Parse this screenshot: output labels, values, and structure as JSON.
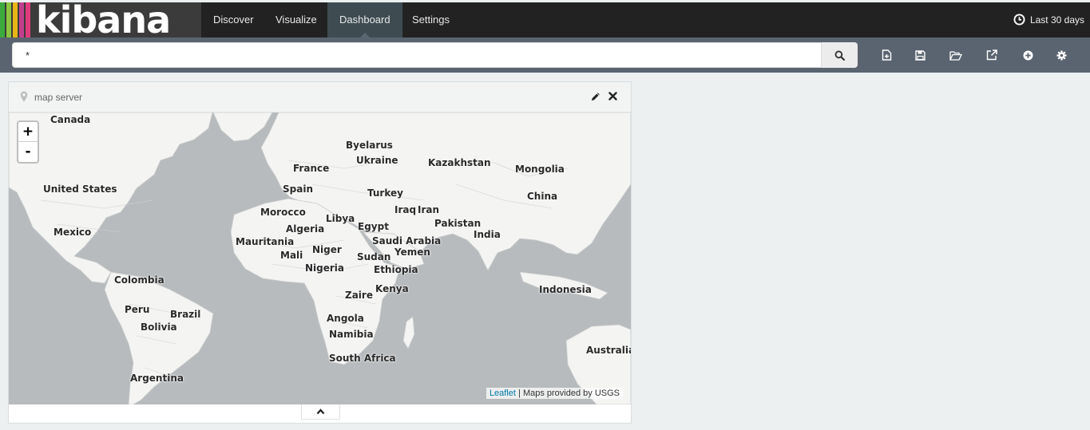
{
  "brand": {
    "logo_text": "kibana",
    "stripe_colors": [
      "#3caa3c",
      "#8cc63f",
      "#e8b416",
      "#c23e8c",
      "#e03b7c"
    ]
  },
  "nav": {
    "tabs": [
      {
        "label": "Discover"
      },
      {
        "label": "Visualize"
      },
      {
        "label": "Dashboard",
        "active": true
      },
      {
        "label": "Settings"
      }
    ],
    "timepicker_label": "Last 30 days"
  },
  "search": {
    "query": "*",
    "icon": "search-icon"
  },
  "toolbar": {
    "icons": [
      "new-dashboard-icon",
      "save-icon",
      "open-icon",
      "share-icon",
      "add-panel-icon",
      "settings-icon"
    ]
  },
  "panel": {
    "title": "map server",
    "title_icon": "map-pin-icon",
    "edit_icon": "pencil-icon",
    "close_icon": "close-icon"
  },
  "map": {
    "zoom_in": "+",
    "zoom_out": "-",
    "attribution_link": "Leaflet",
    "attribution_text": "| Maps provided by USGS",
    "countries": [
      "Canada",
      "United States",
      "Mexico",
      "Colombia",
      "Peru",
      "Brazil",
      "Bolivia",
      "Argentina",
      "Byelarus",
      "Ukraine",
      "France",
      "Spain",
      "Kazakhstan",
      "Mongolia",
      "China",
      "Turkey",
      "Morocco",
      "Libya",
      "Iraq",
      "Iran",
      "Algeria",
      "Egypt",
      "Pakistan",
      "India",
      "Mauritania",
      "Saudi Arabia",
      "Niger",
      "Mali",
      "Sudan",
      "Yemen",
      "Nigeria",
      "Ethiopia",
      "Indonesia",
      "Zaire",
      "Kenya",
      "Angola",
      "Namibia",
      "South Africa",
      "Australia"
    ]
  },
  "colors": {
    "topbar": "#222222",
    "active_tab": "#3e4c52",
    "subbar": "#5a6470",
    "page_bg": "#ecf0f1",
    "ocean": "#b9bdbf",
    "land": "#f4f4f2"
  }
}
